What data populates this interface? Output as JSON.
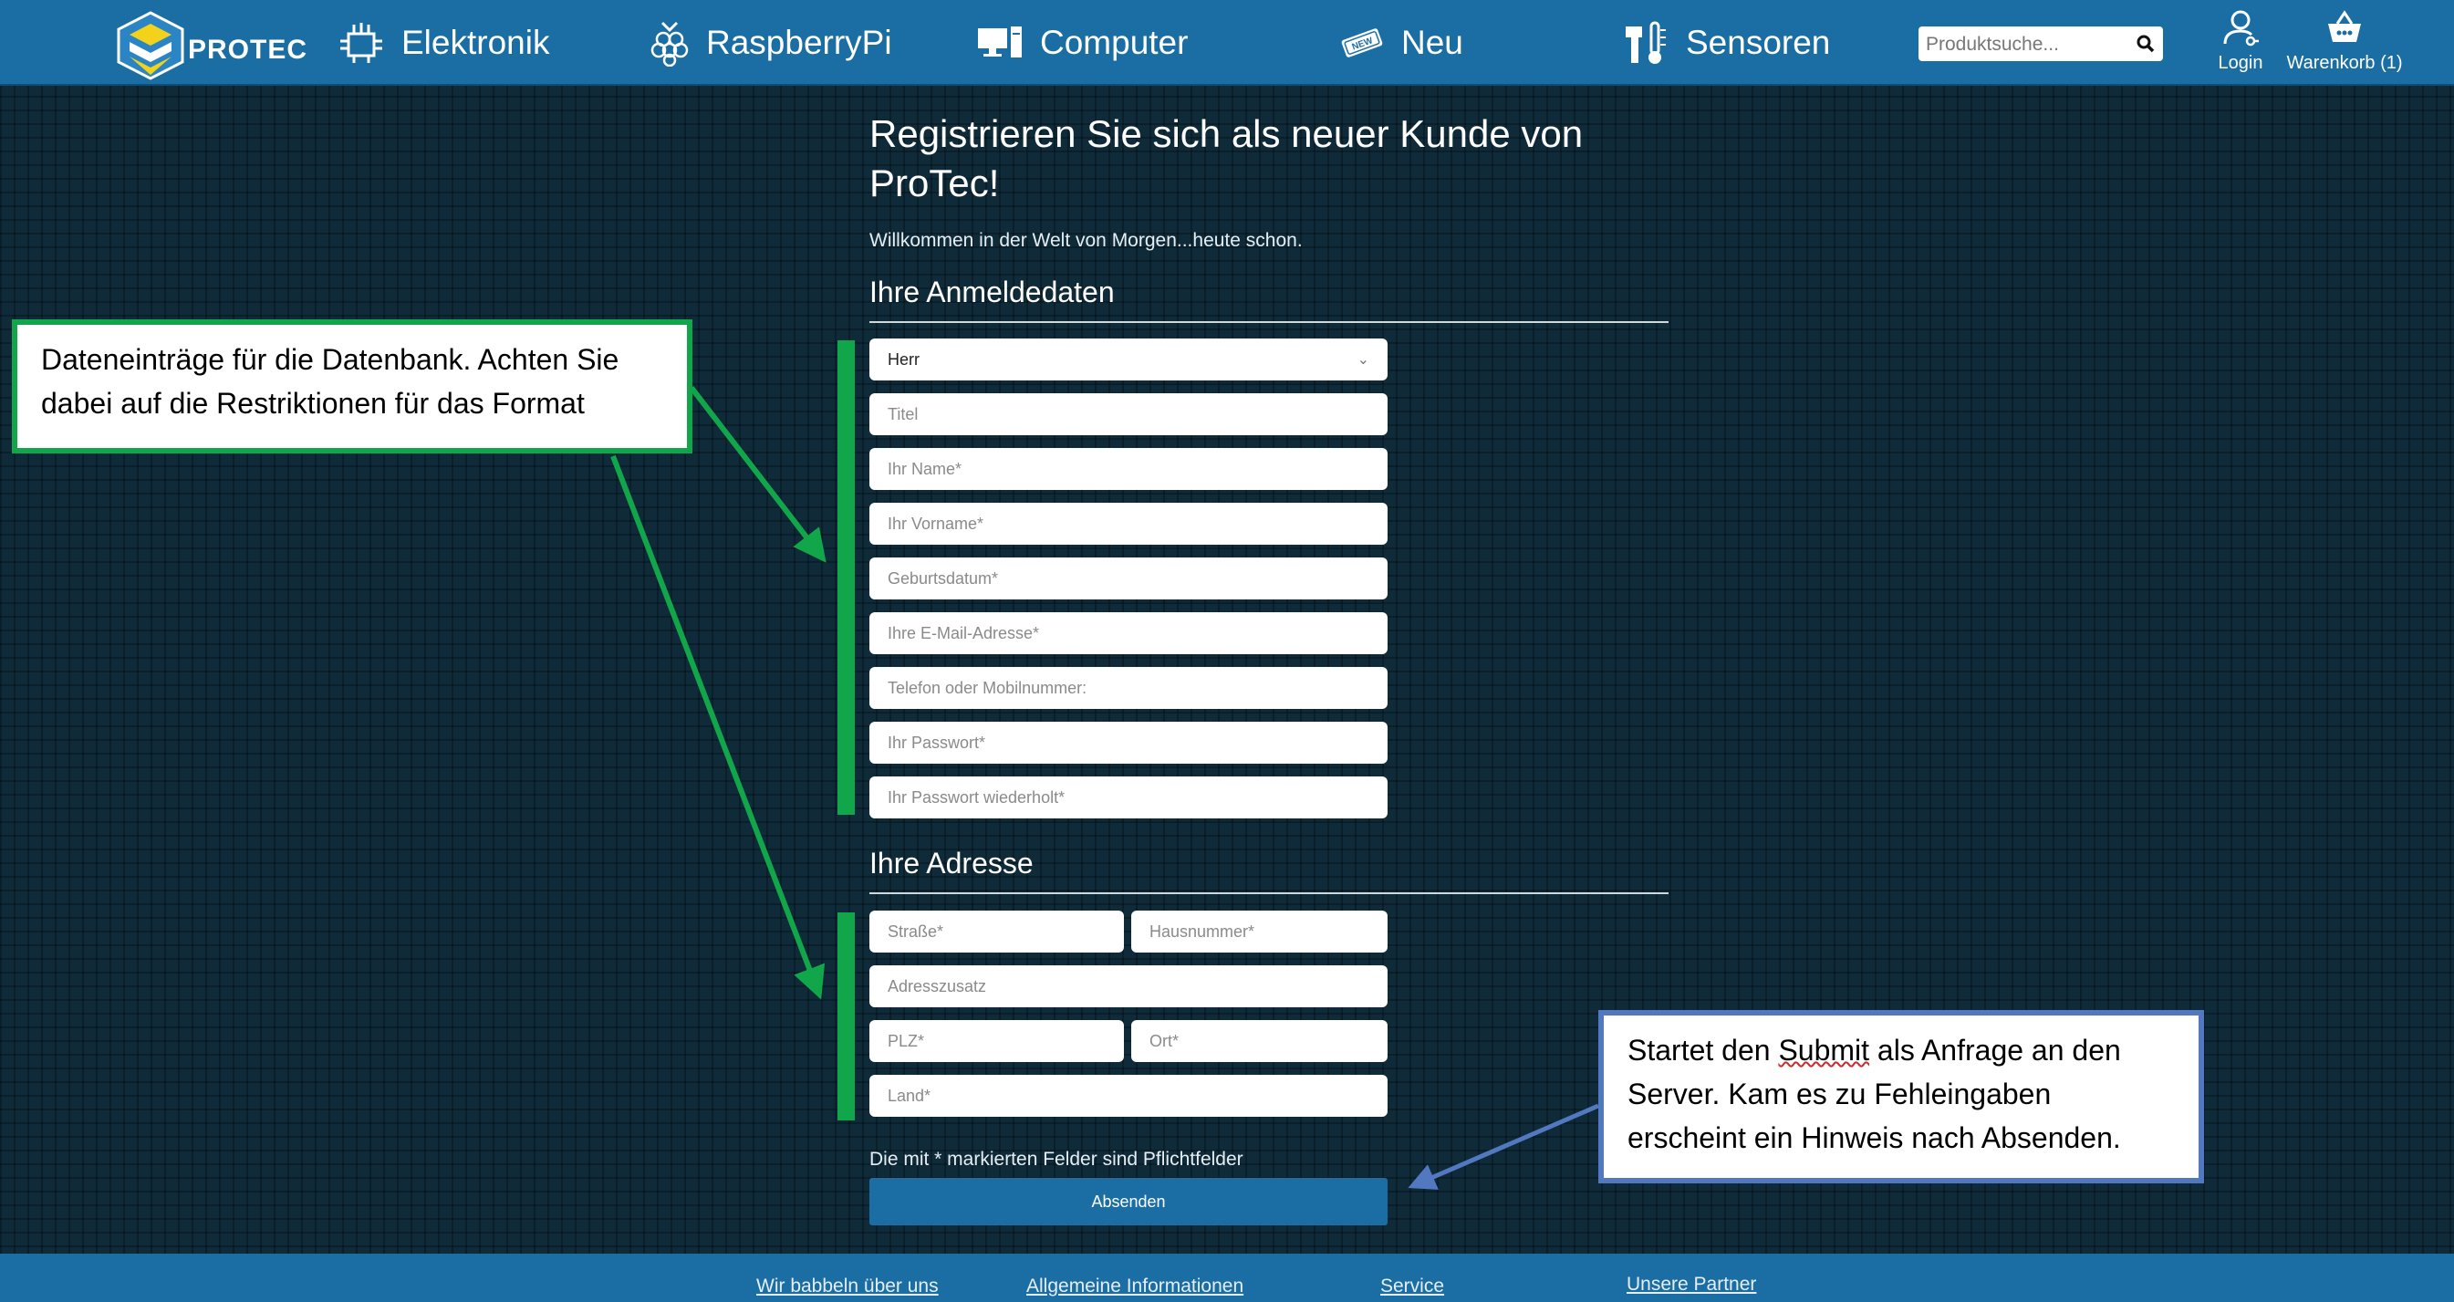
{
  "header": {
    "logo_text": "PROTEC",
    "nav": [
      {
        "label": "Elektronik",
        "icon": "circuit-board-icon"
      },
      {
        "label": "RaspberryPi",
        "icon": "raspberry-icon"
      },
      {
        "label": "Computer",
        "icon": "computer-icon"
      },
      {
        "label": "Neu",
        "icon": "new-badge-icon"
      },
      {
        "label": "Sensoren",
        "icon": "sensor-icon"
      }
    ],
    "search_placeholder": "Produktsuche...",
    "login_label": "Login",
    "cart_label": "Warenkorb (1)"
  },
  "form": {
    "title": "Registrieren Sie sich als neuer Kunde von ProTec!",
    "welcome": "Willkommen in der Welt von Morgen...heute schon.",
    "section_login": "Ihre Anmeldedaten",
    "salutation_selected": "Herr",
    "fields": {
      "titel": "Titel",
      "name": "Ihr Name*",
      "vorname": "Ihr Vorname*",
      "geburtsdatum": "Geburtsdatum*",
      "email": "Ihre E-Mail-Adresse*",
      "telefon": "Telefon oder Mobilnummer:",
      "passwort": "Ihr Passwort*",
      "passwort2": "Ihr Passwort wiederholt*"
    },
    "section_address": "Ihre Adresse",
    "address_fields": {
      "strasse": "Straße*",
      "hausnummer": "Hausnummer*",
      "zusatz": "Adresszusatz",
      "plz": "PLZ*",
      "ort": "Ort*",
      "land": "Land*"
    },
    "required_note": "Die mit * markierten Felder sind Pflichtfelder",
    "submit_label": "Absenden"
  },
  "annotations": {
    "green_text": "Dateneinträge für die Datenbank. Achten Sie dabei auf die Restriktionen für das Format",
    "blue_pre": "Startet den ",
    "blue_word": "Submit",
    "blue_post": " als Anfrage an den Server. Kam es zu Fehleingaben erscheint ein Hinweis nach Absenden.",
    "green_color": "#12a64a",
    "blue_color": "#5278c0"
  },
  "footer": {
    "links": [
      "Wir babbeln über uns",
      "Allgemeine Informationen",
      "Service",
      "Unsere Partner"
    ]
  },
  "colors": {
    "header_bg": "#1b6ea3",
    "page_bg": "#0f2b3a"
  }
}
